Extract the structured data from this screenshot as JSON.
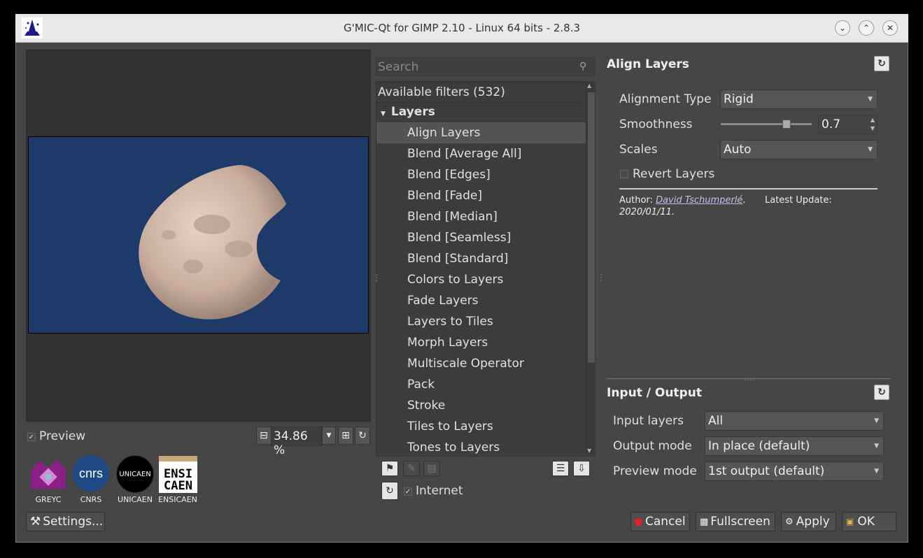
{
  "window": {
    "title": "G'MIC-Qt for GIMP 2.10 - Linux 64 bits - 2.8.3"
  },
  "preview": {
    "checkbox_label": "Preview",
    "zoom": "34.86 %"
  },
  "logos": [
    "GREYC",
    "CNRS",
    "UNICAEN",
    "ENSICAEN"
  ],
  "logo_text": {
    "cnrs": "cnrs",
    "unicaen": "UNICAEN",
    "ensi": "ENSI",
    "caen": "CAEN"
  },
  "settings_label": "Settings...",
  "filters": {
    "search_placeholder": "Search",
    "header": "Available filters (532)",
    "category": "Layers",
    "items": [
      "Align Layers",
      "Blend [Average All]",
      "Blend [Edges]",
      "Blend [Fade]",
      "Blend [Median]",
      "Blend [Seamless]",
      "Blend [Standard]",
      "Colors to Layers",
      "Fade Layers",
      "Layers to Tiles",
      "Morph Layers",
      "Multiscale Operator",
      "Pack",
      "Stroke",
      "Tiles to Layers",
      "Tones to Layers"
    ],
    "selected": "Align Layers",
    "internet_label": "Internet"
  },
  "filter_panel": {
    "title": "Align Layers",
    "alignment_type_label": "Alignment Type",
    "alignment_type_value": "Rigid",
    "smoothness_label": "Smoothness",
    "smoothness_value": "0.7",
    "smoothness_fraction": 0.72,
    "scales_label": "Scales",
    "scales_value": "Auto",
    "revert_label": "Revert Layers",
    "author_prefix": "Author: ",
    "author_name": "David Tschumperlé",
    "author_suffix": ".",
    "update_label": "Latest Update:",
    "update_date": "2020/01/11."
  },
  "io_panel": {
    "title": "Input / Output",
    "input_label": "Input layers",
    "input_value": "All",
    "output_label": "Output mode",
    "output_value": "In place (default)",
    "preview_label": "Preview mode",
    "preview_value": "1st output (default)"
  },
  "buttons": {
    "cancel": "Cancel",
    "fullscreen": "Fullscreen",
    "apply": "Apply",
    "ok": "OK"
  },
  "colors": {
    "cancel_dot": "#e0202a",
    "moon_sky": "#1e3a68"
  }
}
